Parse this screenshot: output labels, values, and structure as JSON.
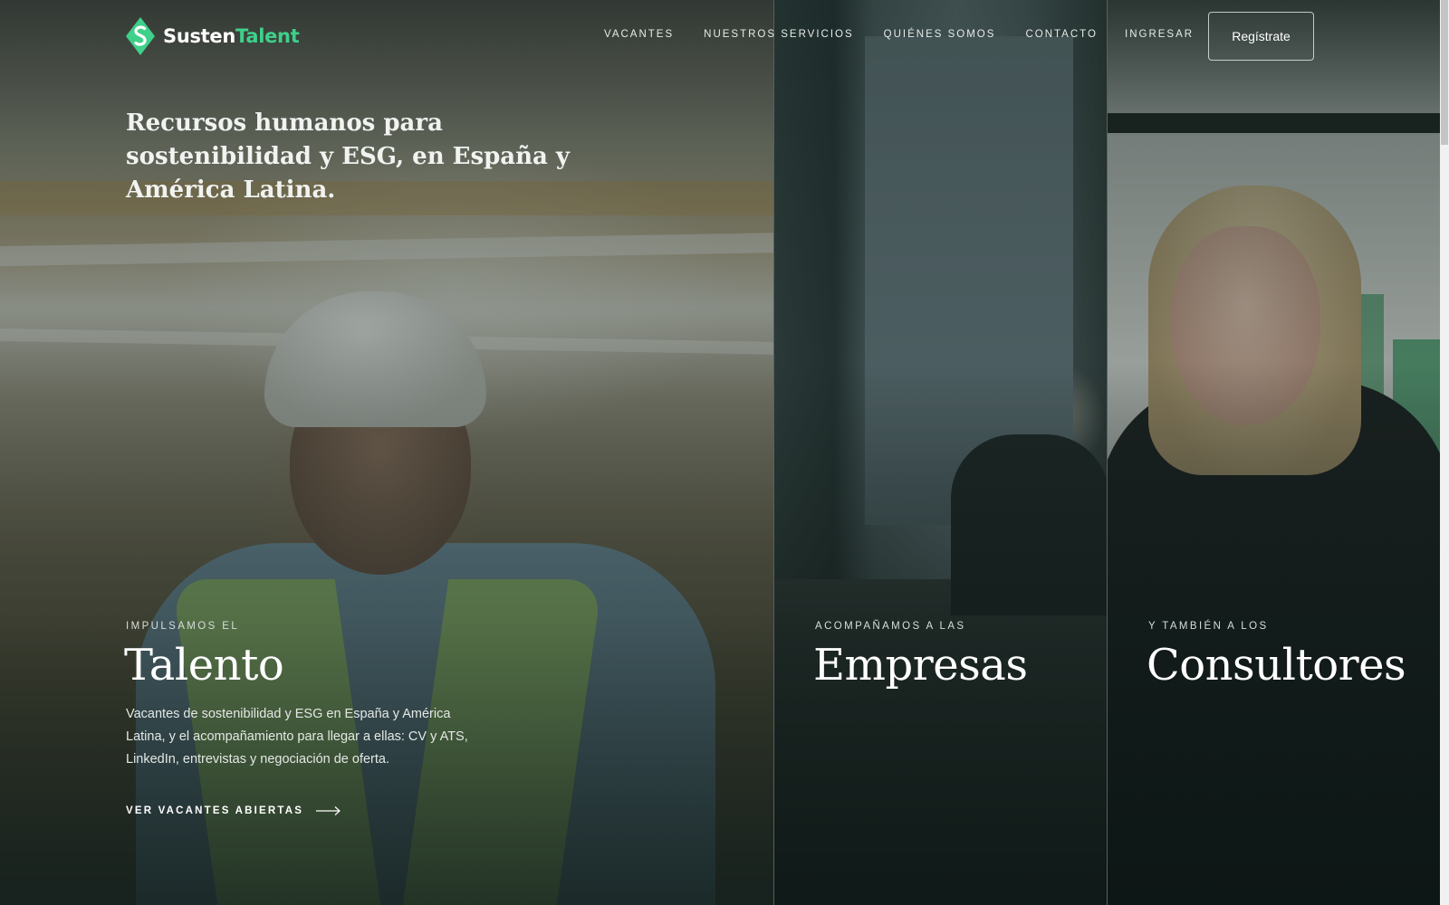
{
  "brand": {
    "name_part1": "Susten",
    "name_part2": "Talent",
    "accent_color": "#3fd08a",
    "logo_icon": "logo-mark-icon"
  },
  "nav": {
    "items": [
      {
        "label": "VACANTES"
      },
      {
        "label": "NUESTROS SERVICIOS"
      },
      {
        "label": "QUIÉNES SOMOS"
      },
      {
        "label": "CONTACTO"
      }
    ],
    "login_label": "INGRESAR",
    "register_label": "Regístrate"
  },
  "hero": {
    "tagline": "Recursos humanos para sostenibilidad y ESG, en España y América Latina.",
    "panels": [
      {
        "eyebrow": "IMPULSAMOS EL",
        "title": "Talento",
        "description": "Vacantes de sostenibilidad y ESG en España y América Latina, y el acompañamiento para llegar a ellas: CV y ATS, LinkedIn, entrevistas y negociación de oferta.",
        "cta_label": "VER VACANTES ABIERTAS",
        "cta_icon": "arrow-right-icon"
      },
      {
        "eyebrow": "ACOMPAÑAMOS A LAS",
        "title": "Empresas"
      },
      {
        "eyebrow": "Y TAMBIÉN A LOS",
        "title": "Consultores"
      }
    ]
  }
}
